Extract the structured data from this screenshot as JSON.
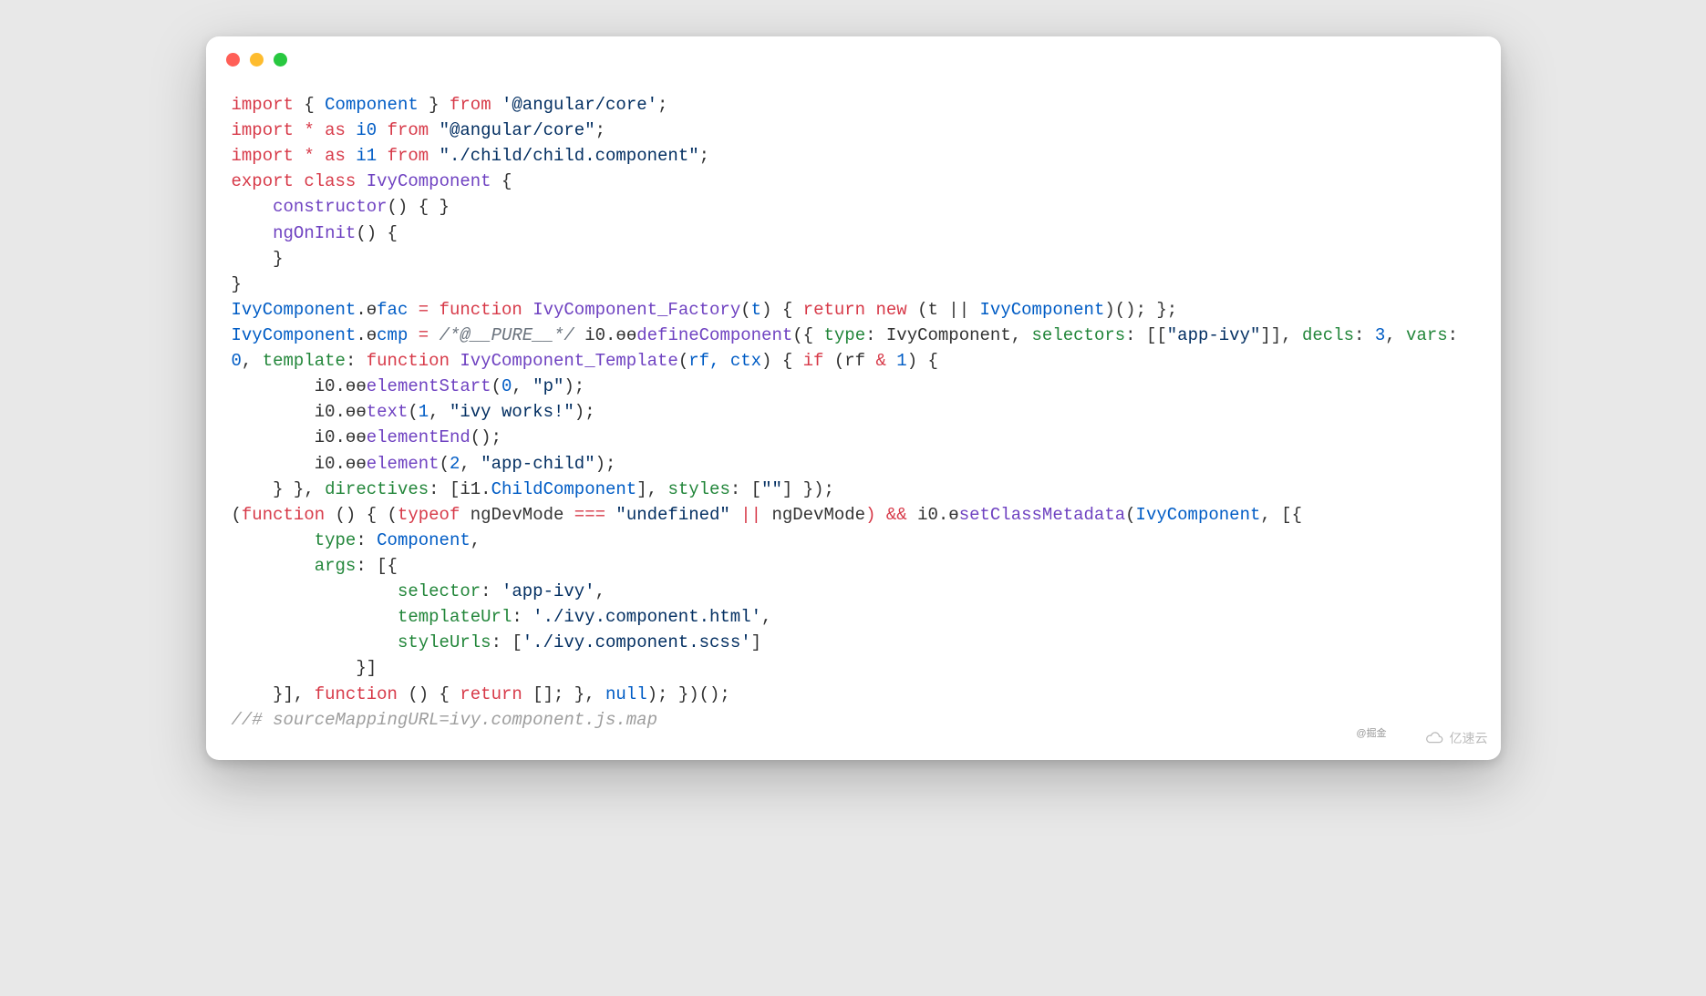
{
  "code": {
    "l01_import": "import",
    "l01_brace_open": "{ ",
    "l01_component": "Component",
    "l01_brace_close": " }",
    "l01_from": "from",
    "l01_str": "'@angular/core'",
    "l01_semi": ";",
    "l02_import": "import",
    "l02_star": " * ",
    "l02_as": "as",
    "l02_i0": " i0 ",
    "l02_from": "from",
    "l02_str": " \"@angular/core\"",
    "l02_semi": ";",
    "l03_import": "import",
    "l03_star": " * ",
    "l03_as": "as",
    "l03_i1": " i1 ",
    "l03_from": "from",
    "l03_str": " \"./child/child.component\"",
    "l03_semi": ";",
    "l04_export": "export",
    "l04_class": "class",
    "l04_name": "IvyComponent",
    "l04_brace": " {",
    "l05_ctor": "    constructor",
    "l05_rest": "() { }",
    "l06_ngOnInit": "    ngOnInit",
    "l06_rest": "() {",
    "l07": "    }",
    "l08": "}",
    "l09_IvyComponent": "IvyComponent",
    "l09_dot": ".ɵ",
    "l09_fac": "fac",
    "l09_eq": " = ",
    "l09_function": "function",
    "l09_fname": " IvyComponent_Factory",
    "l09_paren_t": "(",
    "l09_t": "t",
    "l09_paren_close": ") { ",
    "l09_return": "return",
    "l09_new": " new",
    "l09_rest": " (t || ",
    "l09_Ivy2": "IvyComponent",
    "l09_end": ")(); };",
    "l10_IvyComponent": "IvyComponent",
    "l10_dot": ".ɵ",
    "l10_cmp": "cmp",
    "l10_eq": " = ",
    "l10_comment": "/*@__PURE__*/",
    "l10_i0": " i0.ɵɵ",
    "l10_defineComponent": "defineComponent",
    "l10_open": "({ ",
    "l10_type": "type",
    "l10_typeVal": ": IvyComponent, ",
    "l10_selectors": "selectors",
    "l10_selVal": ": [[",
    "l10_selStr": "\"app-ivy\"",
    "l10_selEnd": "]], ",
    "l11_decls": "decls",
    "l11_declsVal": ": ",
    "l11_3": "3",
    "l11_comma1": ", ",
    "l11_vars": "vars",
    "l11_varsVal": ": ",
    "l11_0": "0",
    "l11_comma2": ", ",
    "l11_template": "template",
    "l11_colon": ": ",
    "l11_function": "function",
    "l11_fname": " IvyComponent_Template",
    "l11_args_open": "(",
    "l11_rf": "rf, ctx",
    "l11_args_close": ") { ",
    "l11_if": "if",
    "l11_cond_open": " (rf ",
    "l11_amp": "&",
    "l11_cond_rest": " ",
    "l11_1": "1",
    "l11_cond_close": ") {",
    "l12_pre": "        i0.ɵɵ",
    "l12_fn": "elementStart",
    "l12_args_open": "(",
    "l12_0": "0",
    "l12_comma": ", ",
    "l12_str": "\"p\"",
    "l12_close": ");",
    "l13_pre": "        i0.ɵɵ",
    "l13_fn": "text",
    "l13_args_open": "(",
    "l13_1": "1",
    "l13_comma": ", ",
    "l13_str": "\"ivy works!\"",
    "l13_close": ");",
    "l14_pre": "        i0.ɵɵ",
    "l14_fn": "elementEnd",
    "l14_close": "();",
    "l15_pre": "        i0.ɵɵ",
    "l15_fn": "element",
    "l15_args_open": "(",
    "l15_2": "2",
    "l15_comma": ", ",
    "l15_str": "\"app-child\"",
    "l15_close": ");",
    "l16_pre": "    } }, ",
    "l16_directives": "directives",
    "l16_dirVal": ": [i1.",
    "l16_ChildComponent": "ChildComponent",
    "l16_mid": "], ",
    "l16_styles": "styles",
    "l16_stylesVal": ": [",
    "l16_empty": "\"\"",
    "l16_end": "] });",
    "l17_open": "(",
    "l17_function": "function",
    "l17_paren": " () { (",
    "l17_typeof": "typeof",
    "l17_ngDevMode1": " ngDevMode ",
    "l17_eqeqeq": "===",
    "l17_undef": " \"undefined\"",
    "l17_or": " || ",
    "l17_ngDevMode2": "ngDevMode",
    "l17_and": ") && ",
    "l17_i0": "i0.ɵ",
    "l17_setClassMetadata": "setClassMetadata",
    "l17_args_open": "(",
    "l17_Ivy": "IvyComponent",
    "l17_rest": ", [{",
    "l18_type": "        type",
    "l18_colon": ": ",
    "l18_Component": "Component",
    "l18_comma": ",",
    "l19_args": "        args",
    "l19_rest": ": [{",
    "l20_selector": "                selector",
    "l20_colon": ": ",
    "l20_str": "'app-ivy'",
    "l20_comma": ",",
    "l21_templateUrl": "                templateUrl",
    "l21_colon": ": ",
    "l21_str": "'./ivy.component.html'",
    "l21_comma": ",",
    "l22_styleUrls": "                styleUrls",
    "l22_colon": ": [",
    "l22_str": "'./ivy.component.scss'",
    "l22_close": "]",
    "l23": "            }]",
    "l24_pre": "    }], ",
    "l24_function": "function",
    "l24_mid": " () { ",
    "l24_return": "return",
    "l24_arr": " []; }, ",
    "l24_null": "null",
    "l24_end": "); })();",
    "l25": "//# sourceMappingURL=ivy.component.js.map"
  },
  "watermark_a": "@掘金",
  "watermark_b": "亿速云"
}
